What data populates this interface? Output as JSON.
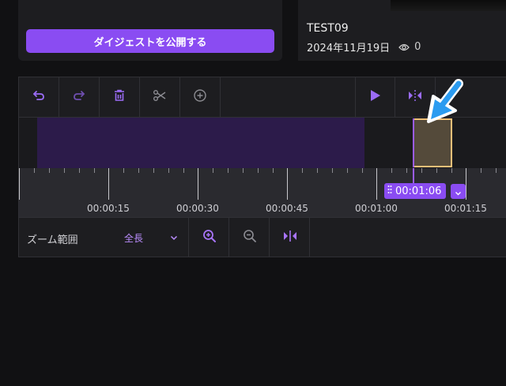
{
  "digest": {
    "publish_label": "ダイジェストを公開する"
  },
  "video": {
    "title": "TEST09",
    "date": "2024年11月19日",
    "views": "0"
  },
  "toolbar": {
    "undo_icon": "undo-icon",
    "redo_icon": "redo-icon",
    "delete_icon": "trash-icon",
    "cut_icon": "scissors-icon",
    "add_icon": "plus-circle-icon",
    "play_icon": "play-icon",
    "split_icon": "split-icon"
  },
  "timeline": {
    "ticks": [
      "00:00:15",
      "00:00:30",
      "00:00:45",
      "00:01:00",
      "00:01:15"
    ],
    "playhead_time": "00:01:06"
  },
  "zoom": {
    "label": "ズーム範囲",
    "selected": "全長",
    "zoom_in_icon": "zoom-in-icon",
    "zoom_out_icon": "zoom-out-icon",
    "fit_icon": "fit-icon"
  },
  "colors": {
    "accent": "#8a4cf2",
    "clip_purple": "#2c1b4a",
    "selected_border": "#f0c078",
    "arrow": "#2b9bf0"
  }
}
